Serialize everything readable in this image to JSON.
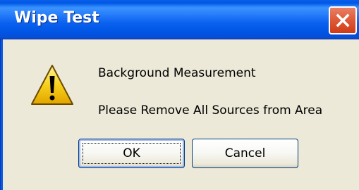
{
  "window": {
    "title": "Wipe Test"
  },
  "titlebar": {
    "close_icon": "close-icon"
  },
  "dialog": {
    "icon": "warning-icon",
    "message_line_1": "Background Measurement",
    "message_line_2": "Please Remove All Sources from Area"
  },
  "buttons": {
    "ok_label": "OK",
    "cancel_label": "Cancel"
  },
  "colors": {
    "titlebar_blue": "#0054e3",
    "dialog_bg": "#ece9d8",
    "close_red": "#e1603f",
    "warning_yellow": "#f7d11b"
  }
}
